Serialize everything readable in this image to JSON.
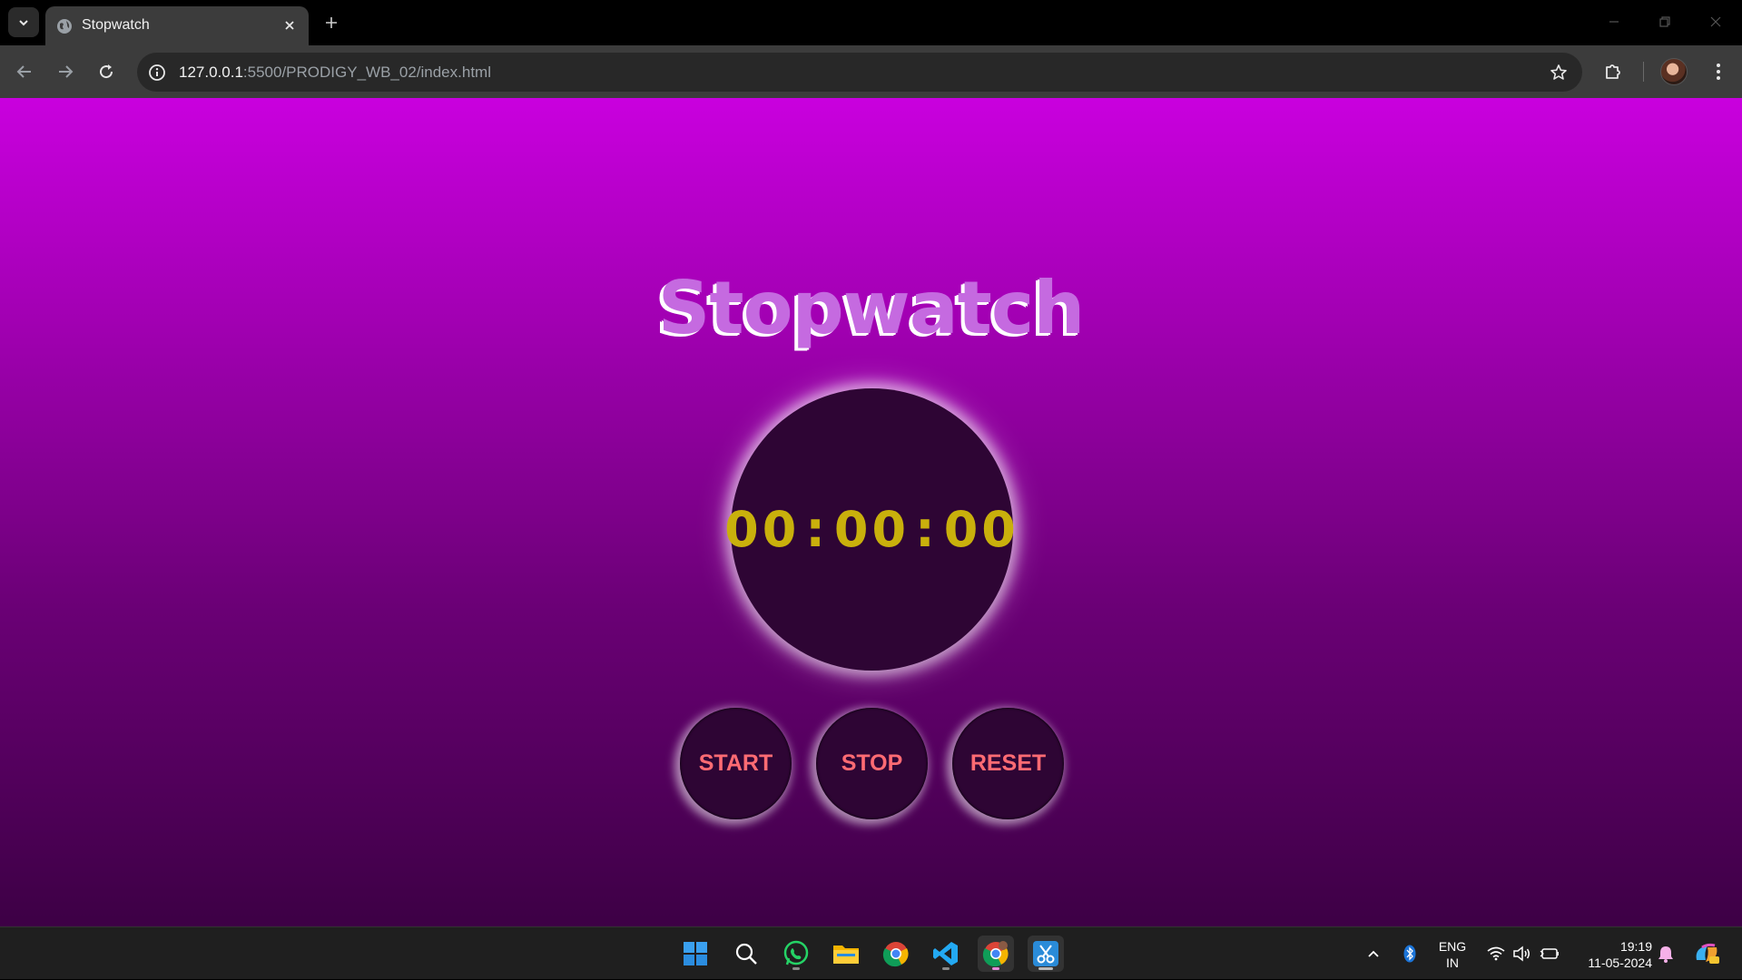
{
  "browser": {
    "tab_title": "Stopwatch",
    "url_host": "127.0.0.1",
    "url_rest": ":5500/PRODIGY_WB_02/index.html"
  },
  "page": {
    "title": "Stopwatch",
    "time": {
      "hours": "00",
      "minutes": "00",
      "seconds": "00",
      "separator": ":"
    },
    "buttons": {
      "start": "START",
      "stop": "STOP",
      "reset": "RESET"
    }
  },
  "taskbar": {
    "lang_line1": "ENG",
    "lang_line2": "IN",
    "time": "19:19",
    "date": "11-05-2024"
  },
  "colors": {
    "page_gradient_top": "#c900de",
    "page_gradient_bottom": "#3d0045",
    "dial_bg": "#2e0534",
    "time_digits": "#c9b00c",
    "button_text": "#ff6b73",
    "title_fill": "#c56ae0"
  }
}
